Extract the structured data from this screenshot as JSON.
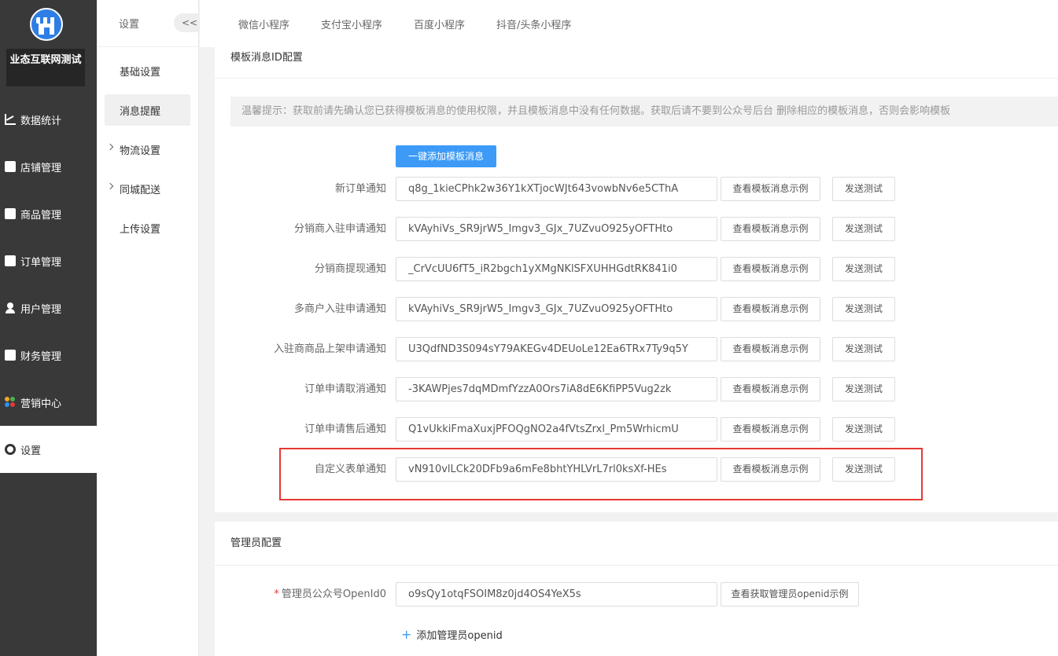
{
  "brand": {
    "name": "业态互联网测试"
  },
  "sidebar": {
    "items": [
      {
        "label": "数据统计",
        "icon": "chart-icon"
      },
      {
        "label": "店铺管理",
        "icon": "store-icon"
      },
      {
        "label": "商品管理",
        "icon": "goods-icon"
      },
      {
        "label": "订单管理",
        "icon": "order-icon"
      },
      {
        "label": "用户管理",
        "icon": "user-icon"
      },
      {
        "label": "财务管理",
        "icon": "finance-icon"
      },
      {
        "label": "营销中心",
        "icon": "marketing-icon"
      },
      {
        "label": "设置",
        "icon": "settings-icon"
      }
    ]
  },
  "subnav": {
    "title": "设置",
    "collapse": "<<",
    "items": [
      {
        "label": "基础设置"
      },
      {
        "label": "消息提醒"
      },
      {
        "label": "物流设置"
      },
      {
        "label": "同城配送"
      },
      {
        "label": "上传设置"
      }
    ]
  },
  "tabs": [
    "微信小程序",
    "支付宝小程序",
    "百度小程序",
    "抖音/头条小程序"
  ],
  "template": {
    "title": "模板消息ID配置",
    "tip": "温馨提示：获取前请先确认您已获得模板消息的使用权限，并且模板消息中没有任何数据。获取后请不要到公众号后台 删除相应的模板消息，否则会影响模板",
    "add_button": "一键添加模板消息",
    "view_label": "查看模板消息示例",
    "test_label": "发送测试",
    "rows": [
      {
        "label": "新订单通知",
        "value": "q8g_1kieCPhk2w36Y1kXTjocWJt643vowbNv6e5CThA"
      },
      {
        "label": "分销商入驻申请通知",
        "value": "kVAyhiVs_SR9jrW5_Imgv3_GJx_7UZvuO925yOFTHto"
      },
      {
        "label": "分销商提现通知",
        "value": "_CrVcUU6fT5_iR2bgch1yXMgNKlSFXUHHGdtRK841i0"
      },
      {
        "label": "多商户入驻申请通知",
        "value": "kVAyhiVs_SR9jrW5_Imgv3_GJx_7UZvuO925yOFTHto"
      },
      {
        "label": "入驻商商品上架申请通知",
        "value": "U3QdfND3S094sY79AKEGv4DEUoLe12Ea6TRx7Ty9q5Y"
      },
      {
        "label": "订单申请取消通知",
        "value": "-3KAWPjes7dqMDmfYzzA0Ors7iA8dE6KfiPP5Vug2zk"
      },
      {
        "label": "订单申请售后通知",
        "value": "Q1vUkkiFmaXuxjPFOQgNO2a4fVtsZrxl_Pm5WrhicmU"
      },
      {
        "label": "自定义表单通知",
        "value": "vN910vlLCk20DFb9a6mFe8bhtYHLVrL7rl0ksXf-HEs"
      }
    ]
  },
  "admin": {
    "title": "管理员配置",
    "required_mark": "*",
    "openid_label": "管理员公众号OpenId0",
    "openid_value": "o9sQy1otqFSOIM8z0jd4OS4YeX5s",
    "view_button": "查看获取管理员openid示例",
    "add_label": "添加管理员openid",
    "add_icon": "+"
  },
  "colors": {
    "accent": "#3d9bf7",
    "highlight": "#e53935",
    "sidebar": "#393939"
  }
}
